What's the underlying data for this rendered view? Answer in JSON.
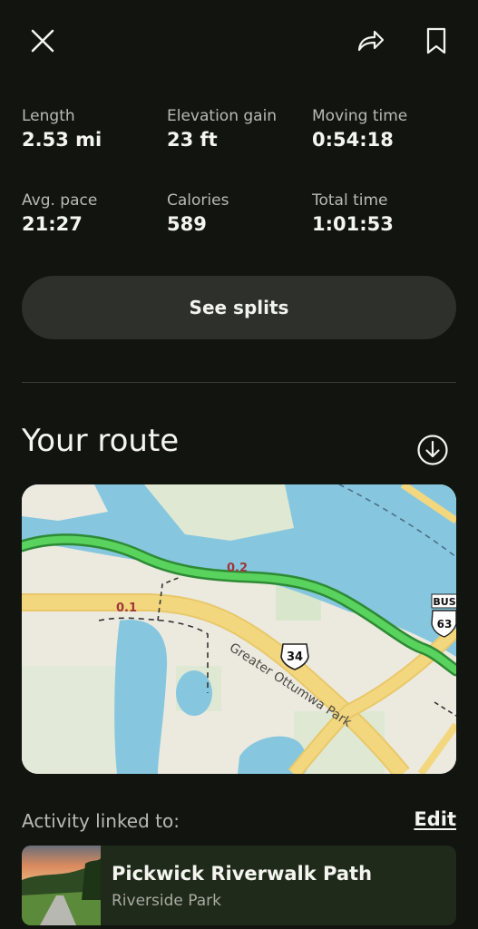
{
  "header": {
    "close_icon": "close-icon",
    "share_icon": "share-icon",
    "bookmark_icon": "bookmark-icon"
  },
  "stats": [
    {
      "label": "Length",
      "value": "2.53 mi"
    },
    {
      "label": "Elevation gain",
      "value": "23 ft"
    },
    {
      "label": "Moving time",
      "value": "0:54:18"
    },
    {
      "label": "Avg. pace",
      "value": "21:27"
    },
    {
      "label": "Calories",
      "value": "589"
    },
    {
      "label": "Total time",
      "value": "1:01:53"
    }
  ],
  "splits_button": "See splits",
  "route": {
    "title": "Your route",
    "download_icon": "download-icon",
    "map": {
      "park_label": "Greater Ottumwa Park",
      "mile_markers": [
        "0.1",
        "0.2"
      ],
      "shield_us": "34",
      "shield_bus_top": "BUS",
      "shield_bus_num": "63",
      "colors": {
        "water": "#86c7df",
        "land": "#eceadf",
        "park": "#dfe8d3",
        "road": "#f3d77e",
        "route": "#5ad25e"
      }
    }
  },
  "linked": {
    "label": "Activity linked to:",
    "edit": "Edit"
  },
  "trail": {
    "name": "Pickwick Riverwalk Path",
    "park": "Riverside Park"
  }
}
